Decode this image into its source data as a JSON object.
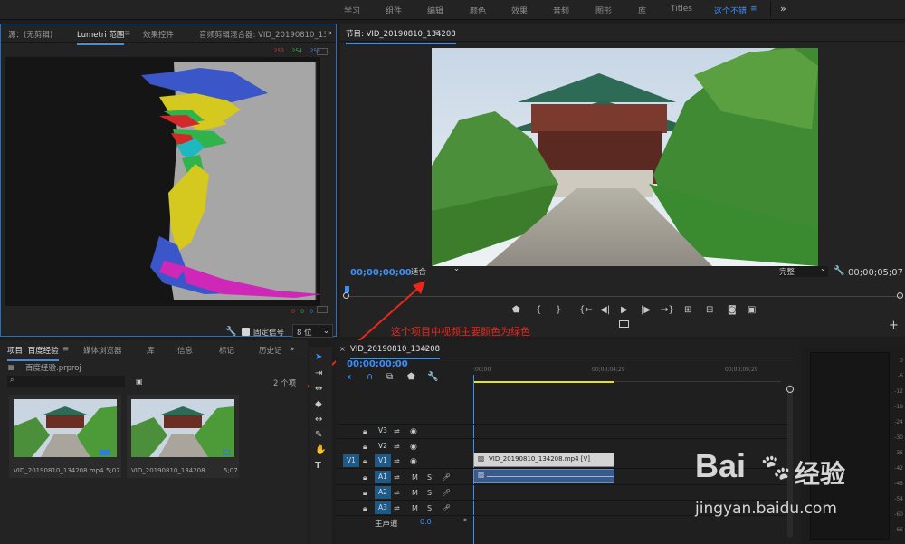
{
  "workspace_tabs": [
    "学习",
    "组件",
    "编辑",
    "颜色",
    "效果",
    "音频",
    "图形",
    "库",
    "Titles",
    "这个不错"
  ],
  "workspace_active_index": 9,
  "workspace_menu": "≡",
  "workspace_more": "»",
  "source_panel": {
    "tabs": [
      "源：(无剪辑)",
      "Lumetri 范围",
      "效果控件",
      "音频剪辑混合器: VID_20190810_1342"
    ],
    "active_tab_index": 1,
    "rgb_top": {
      "r": "253",
      "g": "254",
      "b": "255"
    },
    "rgb_bottom": {
      "r": "0",
      "g": "0",
      "b": "0"
    },
    "clamp_label": "固定信号",
    "clamp_checked": true,
    "bit_depth": "8 位"
  },
  "program_monitor": {
    "title": "节目: VID_20190810_134208",
    "timecode_current": "00;00;00;00",
    "zoom": "适合",
    "quality": "完整",
    "timecode_duration": "00;00;05;07"
  },
  "annotation": "这个项目中视频主要颜色为绿色",
  "project_panel": {
    "tabs": [
      "项目: 百度经验",
      "媒体浏览器",
      "库",
      "信息",
      "标记",
      "历史记"
    ],
    "active_tab_index": 0,
    "file": "百度经验.prproj",
    "item_count": "2 个项",
    "items": [
      {
        "name": "VID_20190810_134208.mp4",
        "duration": "5;07"
      },
      {
        "name": "VID_20190810_134208",
        "duration": "5;07"
      }
    ]
  },
  "timeline": {
    "sequence": "VID_20190810_134208",
    "timecode": "00;00;00;00",
    "ruler": [
      ":00;00",
      "00;00;04;29",
      "00;00;09;29"
    ],
    "video_tracks": [
      "V3",
      "V2",
      "V1"
    ],
    "audio_tracks": [
      "A1",
      "A2",
      "A3"
    ],
    "source_patch": "V1",
    "master_label": "主声道",
    "master_value": "0.0",
    "video_clip": "VID_20190810_134208.mp4 [V]",
    "track_buttons": {
      "mute": "M",
      "solo": "S"
    }
  },
  "audio_meter": {
    "ticks": [
      "0",
      "-6",
      "-12",
      "-18",
      "-24",
      "-30",
      "-36",
      "-42",
      "-48",
      "-54",
      "-60",
      "-66"
    ]
  },
  "watermark": {
    "brand": "Bai",
    "brand_cn": "经验",
    "url": "jingyan.baidu.com"
  }
}
